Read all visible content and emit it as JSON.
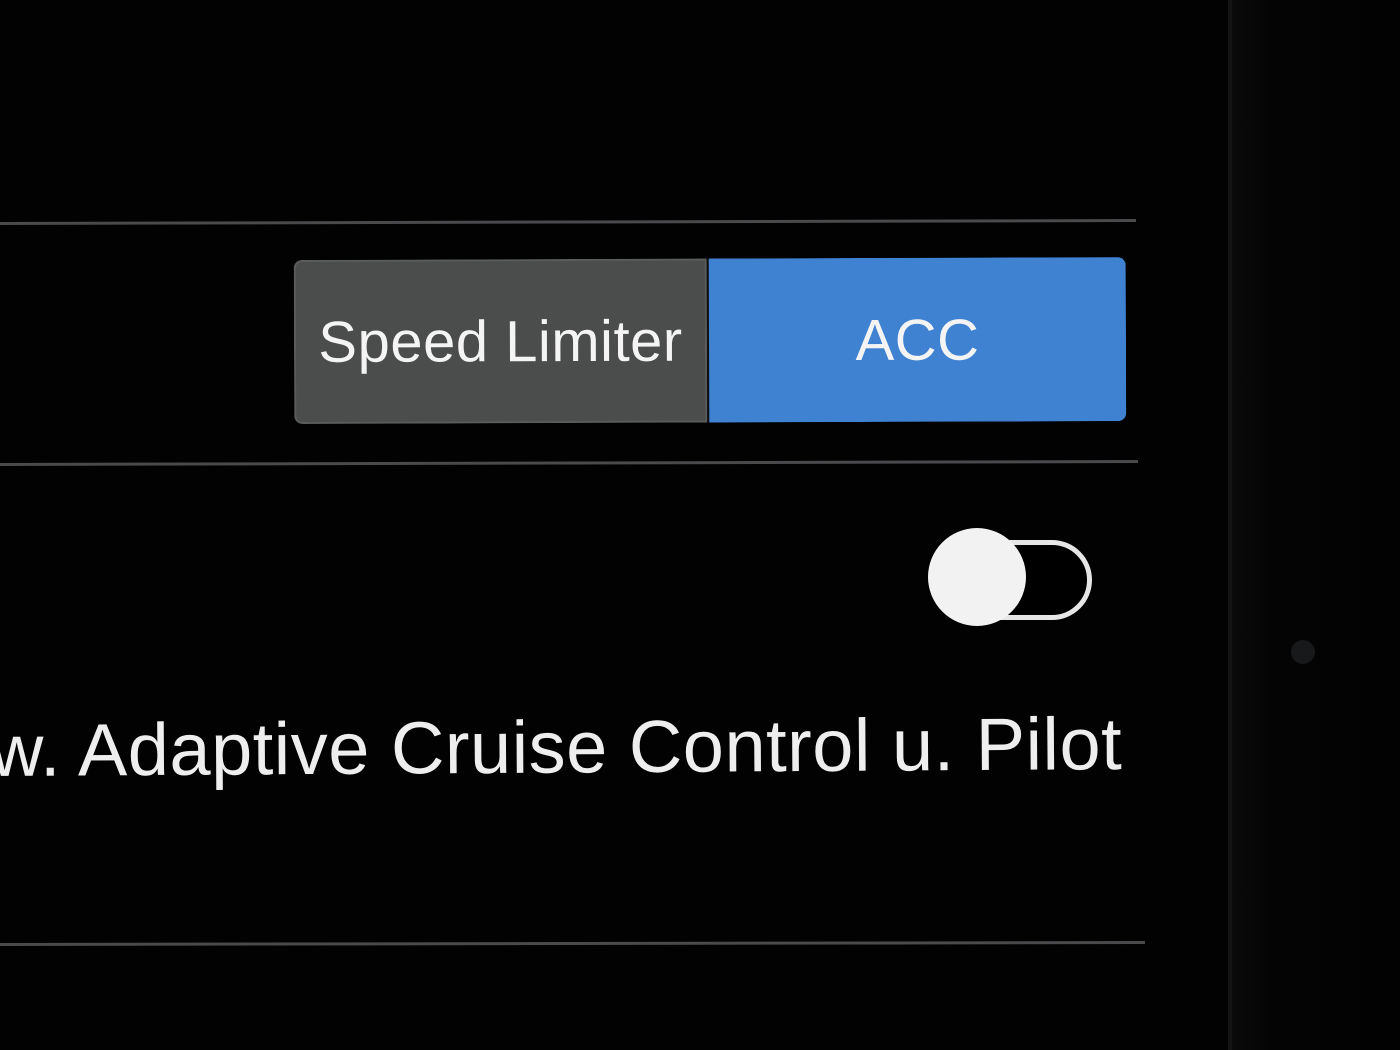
{
  "cruise_mode": {
    "options": [
      {
        "label": "Speed Limiter",
        "selected": false
      },
      {
        "label": "ACC",
        "selected": true
      }
    ]
  },
  "pilot_setting": {
    "label": "w. Adaptive Cruise Control u. Pilot",
    "toggle_on": false
  },
  "colors": {
    "accent": "#3f82d2",
    "inactive_segment": "#4b4c4c",
    "background": "#020203",
    "divider": "#4a4a4d"
  }
}
